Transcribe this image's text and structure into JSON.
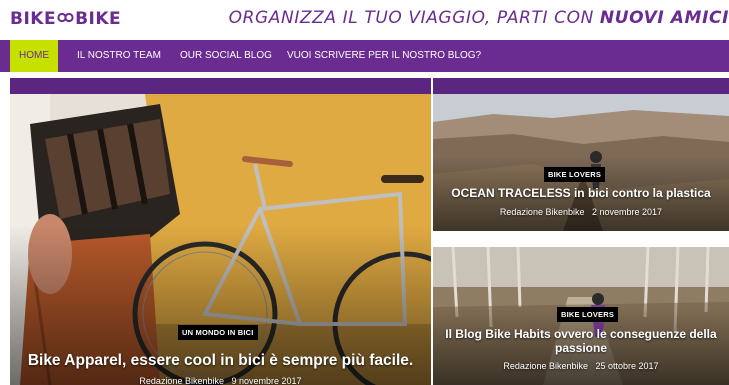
{
  "header": {
    "logo_left": "BIKE",
    "logo_right": "BIKE",
    "tagline_part1": "ORGANIZZA IL TUO VIAGGIO, PARTI CON ",
    "tagline_part2": "NUOVI AMICI"
  },
  "nav": {
    "items": [
      {
        "label": "HOME",
        "active": true
      },
      {
        "label": "IL NOSTRO TEAM",
        "active": false
      },
      {
        "label": "OUR SOCIAL BLOG",
        "active": false
      },
      {
        "label": "VUOI SCRIVERE PER IL NOSTRO BLOG?",
        "active": false
      }
    ]
  },
  "colors": {
    "brand": "#6a2c91",
    "accent": "#c6e000"
  },
  "posts": [
    {
      "category": "UN MONDO IN BICI",
      "title": "Bike Apparel, essere cool in bici è sempre più facile.",
      "author": "Redazione Bikenbike",
      "date": "9 novembre 2017"
    },
    {
      "category": "BIKE LOVERS",
      "title": "OCEAN TRACELESS in bici contro la plastica",
      "author": "Redazione Bikenbike",
      "date": "2 novembre 2017"
    },
    {
      "category": "BIKE LOVERS",
      "title": "Il Blog Bike Habits ovvero le conseguenze della passione",
      "author": "Redazione Bikenbike",
      "date": "25 ottobre 2017"
    }
  ]
}
